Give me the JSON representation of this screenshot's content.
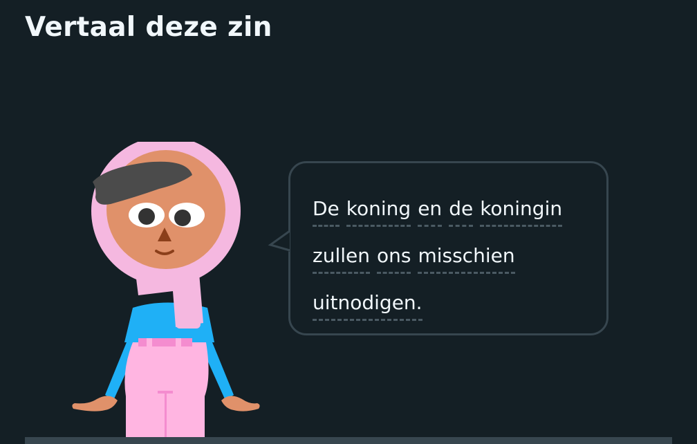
{
  "challenge": {
    "title": "Vertaal deze zin"
  },
  "character": {
    "name": "character-illustration"
  },
  "sentence": {
    "lines": [
      [
        "De",
        "koning",
        "en",
        "de",
        "koningin"
      ],
      [
        "zullen",
        "ons",
        "misschien"
      ],
      [
        "uitnodigen."
      ]
    ]
  },
  "colors": {
    "background": "#141f25",
    "text": "#f1f7fb",
    "bubble_border": "#37464f",
    "dash": "#4b5a63",
    "hijab": "#f5b8e0",
    "skin": "#e0916a",
    "shirt": "#1fb0f6",
    "pants": "#ffb5e1",
    "hair": "#4b4b4b"
  }
}
